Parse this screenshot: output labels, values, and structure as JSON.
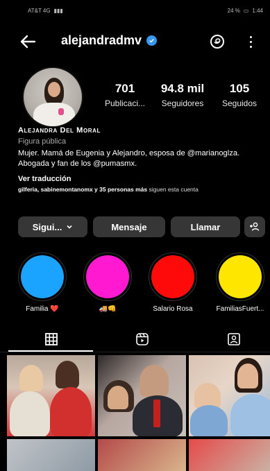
{
  "status_bar": {
    "carrier": "AT&T 4G",
    "battery": "24 %",
    "time": "1:44"
  },
  "header": {
    "username": "alejandradmv",
    "verified": true,
    "icons": [
      "back-arrow-icon",
      "verified-badge-icon",
      "threads-icon",
      "more-vertical-icon"
    ]
  },
  "profile": {
    "stats": {
      "posts_value": "701",
      "posts_label": "Publicaci...",
      "followers_value": "94.8 mil",
      "followers_label": "Seguidores",
      "following_value": "105",
      "following_label": "Seguidos"
    },
    "name": "Alejandra Del Moral",
    "category": "Figura pública",
    "bio": "Mujer. Mamá de Eugenia y Alejandro, esposa de @marianoglza. Abogada y fan de los @pumasmx.",
    "translate": "Ver traducción",
    "mutual_names": "gilferia, sabinemontanomx y 35 personas más",
    "mutual_suffix": "siguen esta cuenta"
  },
  "actions": {
    "follow": "Sigui...",
    "message": "Mensaje",
    "call": "Llamar"
  },
  "highlights": [
    {
      "label": "Familia ❤️",
      "color": "#1aa3ff"
    },
    {
      "label": "",
      "color": "#ff1ad1"
    },
    {
      "label": "Salario Rosa",
      "color": "#ff0a0a"
    },
    {
      "label": "FamiliasFuert...",
      "color": "#ffe600"
    }
  ],
  "tabs": [
    "grid-icon",
    "reels-icon",
    "tagged-icon"
  ]
}
